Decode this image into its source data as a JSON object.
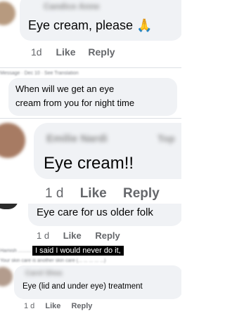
{
  "comments": [
    {
      "name": "Candice Anne",
      "text": "Eye cream, please",
      "emoji": "🙏",
      "time": "1d",
      "like": "Like",
      "reply": "Reply"
    },
    {
      "header": "Message · Dec 10 · See Translation",
      "text_line1": "When will we get an eye",
      "text_line2": "cream from you for night time"
    },
    {
      "name": "Emilie Nardi",
      "badge": "Top",
      "text": "Eye cream!!",
      "time": "1 d",
      "like": "Like",
      "reply": "Reply"
    },
    {
      "text": "Eye care for us older folk",
      "time": "1 d",
      "like": "Like",
      "reply": "Reply"
    },
    {
      "overlay": "I said I would never do it,",
      "name": "Carol Shea",
      "text": "Eye (lid and under eye) treatment",
      "time": "1 d",
      "like": "Like",
      "reply": "Reply"
    }
  ],
  "colors": {
    "bubble": "#f0f2f5",
    "meta": "#65676b",
    "text": "#050505",
    "overlay": "#000000"
  }
}
